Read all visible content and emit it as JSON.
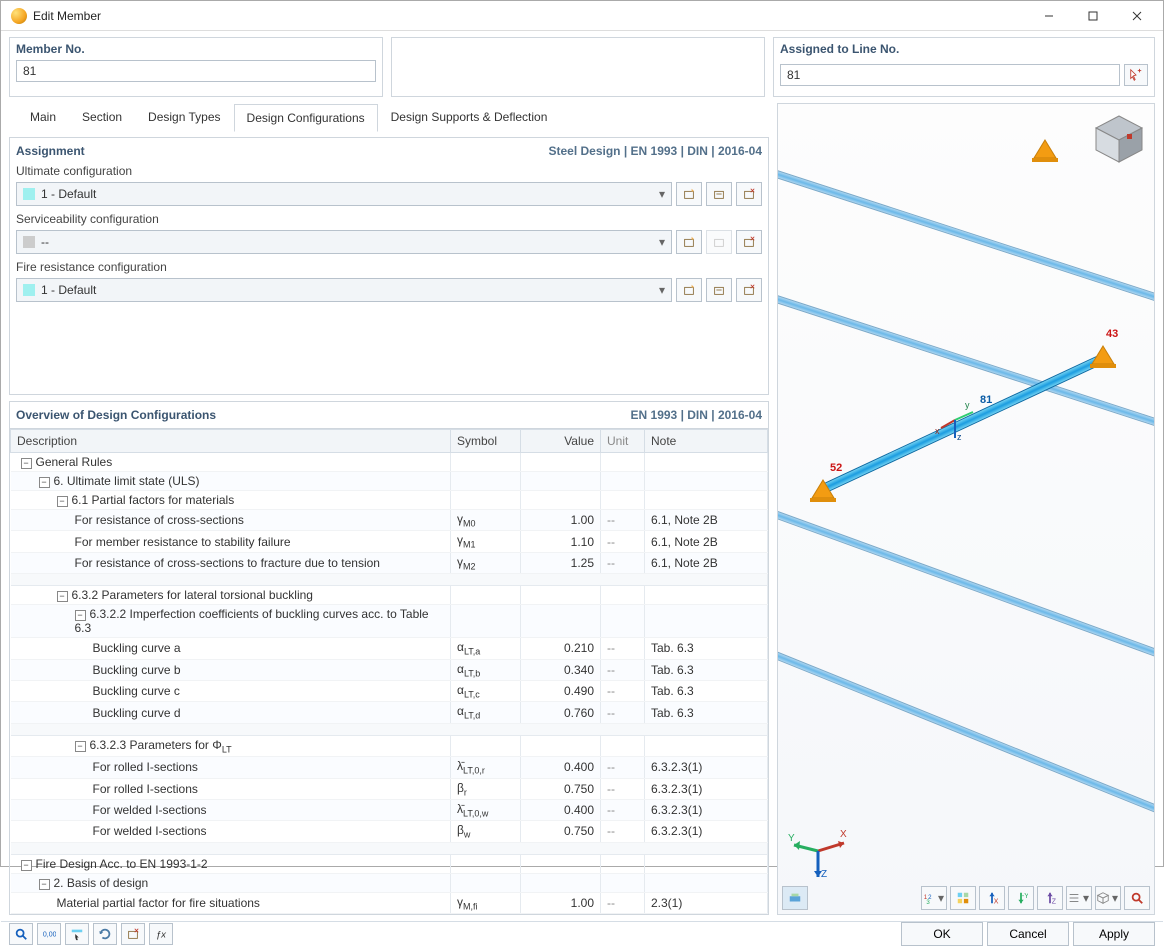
{
  "window": {
    "title": "Edit Member"
  },
  "memberNo": {
    "label": "Member No.",
    "value": "81"
  },
  "assigned": {
    "label": "Assigned to Line No.",
    "value": "81"
  },
  "tabs": [
    {
      "label": "Main"
    },
    {
      "label": "Section"
    },
    {
      "label": "Design Types"
    },
    {
      "label": "Design Configurations"
    },
    {
      "label": "Design Supports & Deflection"
    }
  ],
  "assignment": {
    "header": "Assignment",
    "standard": "Steel Design | EN 1993 | DIN | 2016-04",
    "ultimate": {
      "label": "Ultimate configuration",
      "value": "1 - Default"
    },
    "serviceability": {
      "label": "Serviceability configuration",
      "value": "--"
    },
    "fire": {
      "label": "Fire resistance configuration",
      "value": "1 - Default"
    }
  },
  "overview": {
    "header": "Overview of Design Configurations",
    "standard": "EN 1993 | DIN | 2016-04",
    "columns": {
      "desc": "Description",
      "symbol": "Symbol",
      "value": "Value",
      "unit": "Unit",
      "note": "Note"
    },
    "rows": [
      {
        "t": "h",
        "lvl": 0,
        "desc": "General Rules"
      },
      {
        "t": "h",
        "lvl": 1,
        "desc": "6. Ultimate limit state (ULS)"
      },
      {
        "t": "h",
        "lvl": 2,
        "desc": "6.1 Partial factors for materials"
      },
      {
        "t": "d",
        "lvl": 3,
        "desc": "For resistance of cross-sections",
        "sym": "γ",
        "sub": "M0",
        "val": "1.00",
        "unit": "--",
        "note": "6.1, Note 2B"
      },
      {
        "t": "d",
        "lvl": 3,
        "desc": "For member resistance to stability failure",
        "sym": "γ",
        "sub": "M1",
        "val": "1.10",
        "unit": "--",
        "note": "6.1, Note 2B"
      },
      {
        "t": "d",
        "lvl": 3,
        "desc": "For resistance of cross-sections to fracture due to tension",
        "sym": "γ",
        "sub": "M2",
        "val": "1.25",
        "unit": "--",
        "note": "6.1, Note 2B"
      },
      {
        "t": "sp"
      },
      {
        "t": "h",
        "lvl": 2,
        "desc": "6.3.2 Parameters for lateral torsional buckling"
      },
      {
        "t": "h",
        "lvl": 3,
        "desc": "6.3.2.2 Imperfection coefficients of buckling curves acc. to Table 6.3"
      },
      {
        "t": "d",
        "lvl": 4,
        "desc": "Buckling curve a",
        "sym": "α",
        "sub": "LT,a",
        "val": "0.210",
        "unit": "--",
        "note": "Tab. 6.3"
      },
      {
        "t": "d",
        "lvl": 4,
        "desc": "Buckling curve b",
        "sym": "α",
        "sub": "LT,b",
        "val": "0.340",
        "unit": "--",
        "note": "Tab. 6.3"
      },
      {
        "t": "d",
        "lvl": 4,
        "desc": "Buckling curve c",
        "sym": "α",
        "sub": "LT,c",
        "val": "0.490",
        "unit": "--",
        "note": "Tab. 6.3"
      },
      {
        "t": "d",
        "lvl": 4,
        "desc": "Buckling curve d",
        "sym": "α",
        "sub": "LT,d",
        "val": "0.760",
        "unit": "--",
        "note": "Tab. 6.3"
      },
      {
        "t": "sp"
      },
      {
        "t": "h",
        "lvl": 3,
        "desc": "6.3.2.3 Parameters for Φ",
        "sub": "LT"
      },
      {
        "t": "d",
        "lvl": 4,
        "desc": "For rolled I-sections",
        "sym": "λ̄",
        "sub": "LT,0,r",
        "val": "0.400",
        "unit": "--",
        "note": "6.3.2.3(1)"
      },
      {
        "t": "d",
        "lvl": 4,
        "desc": "For rolled I-sections",
        "sym": "β",
        "sub": "r",
        "val": "0.750",
        "unit": "--",
        "note": "6.3.2.3(1)"
      },
      {
        "t": "d",
        "lvl": 4,
        "desc": "For welded I-sections",
        "sym": "λ̄",
        "sub": "LT,0,w",
        "val": "0.400",
        "unit": "--",
        "note": "6.3.2.3(1)"
      },
      {
        "t": "d",
        "lvl": 4,
        "desc": "For welded I-sections",
        "sym": "β",
        "sub": "w",
        "val": "0.750",
        "unit": "--",
        "note": "6.3.2.3(1)"
      },
      {
        "t": "sp"
      },
      {
        "t": "h",
        "lvl": 0,
        "desc": "Fire Design Acc. to EN 1993-1-2"
      },
      {
        "t": "h",
        "lvl": 1,
        "desc": "2. Basis of design"
      },
      {
        "t": "d",
        "lvl": 2,
        "desc": "Material partial factor for fire situations",
        "sym": "γ",
        "sub": "M,fi",
        "val": "1.00",
        "unit": "--",
        "note": "2.3(1)"
      }
    ]
  },
  "viewport": {
    "nodes": [
      {
        "n": "52"
      },
      {
        "n": "43"
      }
    ],
    "member_label": "81"
  },
  "buttons": {
    "ok": "OK",
    "cancel": "Cancel",
    "apply": "Apply"
  }
}
